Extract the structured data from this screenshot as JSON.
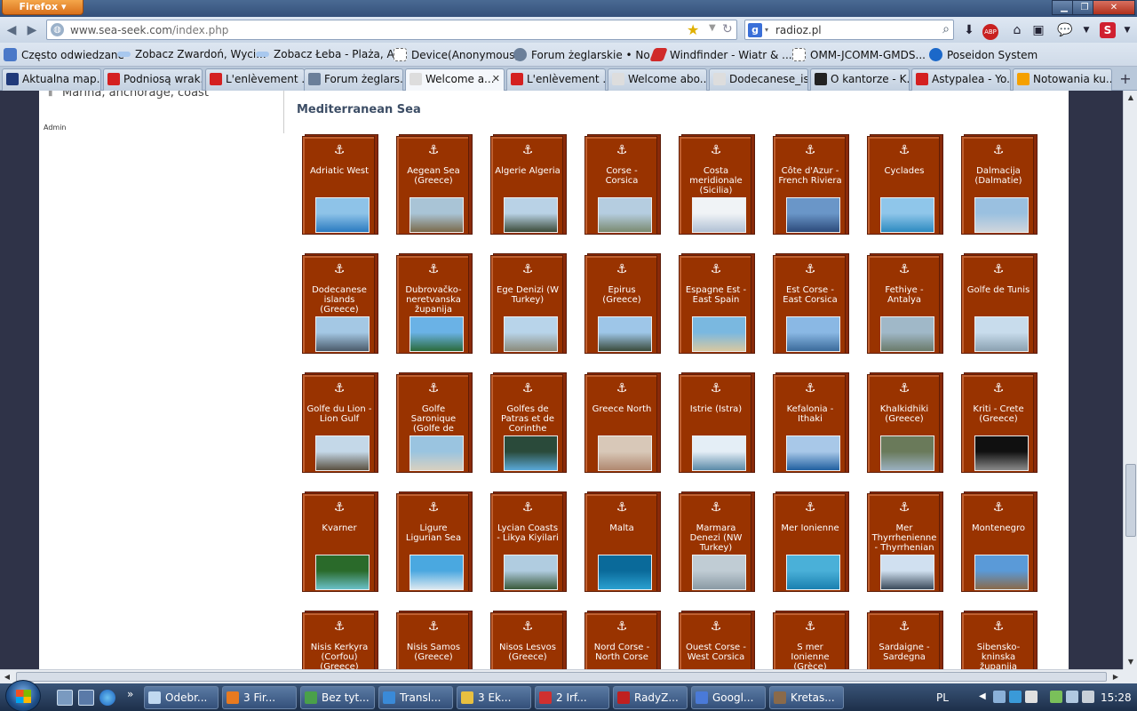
{
  "browser": {
    "app_button": "Firefox",
    "url_host": "www.sea-seek.com",
    "url_path": "/index.php",
    "search_engine": "g",
    "search_text": "radioz.pl"
  },
  "bookmarks": [
    {
      "label": "Często odwiedzane",
      "color": "#4a78c8"
    },
    {
      "label": "Zobacz Zwardoń, Wyci...",
      "color": "#a8c8ee"
    },
    {
      "label": "Zobacz Łeba - Plaża, A...",
      "color": "#a8c8ee"
    },
    {
      "label": "Device(Anonymous)",
      "color": "#ffffff"
    },
    {
      "label": "Forum żeglarskie • No...",
      "color": "#6b7f99"
    },
    {
      "label": "Windfinder - Wiatr & ...",
      "color": "#d02a2a"
    },
    {
      "label": "OMM-JCOMM-GMDS...",
      "color": "#ffffff"
    },
    {
      "label": "Poseidon System",
      "color": "#1b68c9"
    }
  ],
  "tabs": [
    {
      "label": "Aktualna map...",
      "color": "#203a7a"
    },
    {
      "label": "Podniosą wrak...",
      "color": "#d42020"
    },
    {
      "label": "L'enlèvement ...",
      "color": "#d42020"
    },
    {
      "label": "Forum żeglars...",
      "color": "#6b7f99"
    },
    {
      "label": "Welcome a...",
      "color": "#dddddd",
      "active": true
    },
    {
      "label": "L'enlèvement ...",
      "color": "#d42020"
    },
    {
      "label": "Welcome abo...",
      "color": "#dddddd"
    },
    {
      "label": "Dodecanese_is...",
      "color": "#dddddd"
    },
    {
      "label": "O kantorze - K...",
      "color": "#222222"
    },
    {
      "label": "Astypalea - Yo...",
      "color": "#d42020"
    },
    {
      "label": "Notowania ku...",
      "color": "#f5a000"
    }
  ],
  "sidebar": {
    "marina_text": "Marina, anchorage, coast",
    "admin_link": "Admin"
  },
  "section_title": "Mediterranean Sea",
  "regions": [
    {
      "name": "Adriatic West",
      "thumb": [
        "#8ec3e8",
        "#2a7ac0"
      ]
    },
    {
      "name": "Aegean Sea (Greece)",
      "thumb": [
        "#a9c4d6",
        "#7a6a4a"
      ]
    },
    {
      "name": "Algerie Algeria",
      "thumb": [
        "#b9d2e6",
        "#3b4a38"
      ]
    },
    {
      "name": "Corse - Corsica",
      "thumb": [
        "#b5cde0",
        "#7a8a70"
      ]
    },
    {
      "name": "Costa meridionale (Sicilia)",
      "thumb": [
        "#f0f3f6",
        "#b0c0d4"
      ]
    },
    {
      "name": "Côte d'Azur - French Riviera",
      "thumb": [
        "#6a96c8",
        "#2b4a7a"
      ]
    },
    {
      "name": "Cyclades",
      "thumb": [
        "#8fc6ea",
        "#2d8ac0"
      ]
    },
    {
      "name": "Dalmacija (Dalmatie)",
      "thumb": [
        "#9ac0e0",
        "#d0d6dc"
      ]
    },
    {
      "name": "Dodecanese islands (Greece)",
      "thumb": [
        "#a4c8e4",
        "#4a5a6a"
      ]
    },
    {
      "name": "Dubrovačko-neretvanska županija",
      "thumb": [
        "#6ab2e6",
        "#2a6a3a"
      ]
    },
    {
      "name": "Ege Denizi (W Turkey)",
      "thumb": [
        "#b8d4ea",
        "#8a8a7a"
      ]
    },
    {
      "name": "Epirus (Greece)",
      "thumb": [
        "#9ec6e8",
        "#3a4a3a"
      ]
    },
    {
      "name": "Espagne Est - East Spain",
      "thumb": [
        "#7ab8e0",
        "#d8c8a0"
      ]
    },
    {
      "name": "Est Corse - East Corsica",
      "thumb": [
        "#8ab8e4",
        "#3a6a9a"
      ]
    },
    {
      "name": "Fethiye - Antalya",
      "thumb": [
        "#a0b8c8",
        "#6a7a6a"
      ]
    },
    {
      "name": "Golfe de Tunis",
      "thumb": [
        "#c8dcec",
        "#8aa0b0"
      ]
    },
    {
      "name": "Golfe du Lion - Lion Gulf",
      "thumb": [
        "#c4d8e8",
        "#5a5040"
      ]
    },
    {
      "name": "Golfe Saronique (Golfe de",
      "thumb": [
        "#9ac4e0",
        "#d8d0c0"
      ]
    },
    {
      "name": "Golfes de Patras et de Corinthe",
      "thumb": [
        "#2a4a3a",
        "#5aa8d8"
      ]
    },
    {
      "name": "Greece North",
      "thumb": [
        "#d8c8b8",
        "#b08870"
      ]
    },
    {
      "name": "Istrie (Istra)",
      "thumb": [
        "#e4eef6",
        "#5a8aa8"
      ]
    },
    {
      "name": "Kefalonia - Ithaki",
      "thumb": [
        "#a8c8e8",
        "#2060a0"
      ]
    },
    {
      "name": "Khalkidhiki (Greece)",
      "thumb": [
        "#6a7a5a",
        "#9ab0c0"
      ]
    },
    {
      "name": "Kriti - Crete (Greece)",
      "thumb": [
        "#101010",
        "#8a8a8a"
      ]
    },
    {
      "name": "Kvarner",
      "thumb": [
        "#2a6a2a",
        "#6ac0c8"
      ]
    },
    {
      "name": "Ligure Ligurian Sea",
      "thumb": [
        "#4aa8e0",
        "#dce8f0"
      ]
    },
    {
      "name": "Lycian Coasts - Likya Kiyilari",
      "thumb": [
        "#b0cce0",
        "#3a5a3a"
      ]
    },
    {
      "name": "Malta",
      "thumb": [
        "#0a6a9a",
        "#2aa0d0"
      ]
    },
    {
      "name": "Marmara Denezi (NW Turkey)",
      "thumb": [
        "#c0ccd4",
        "#8a9aa4"
      ]
    },
    {
      "name": "Mer Ionienne",
      "thumb": [
        "#4ab0d8",
        "#1a80b0"
      ]
    },
    {
      "name": "Mer Thyrrhenienne - Thyrrhenian",
      "thumb": [
        "#d0e0f0",
        "#3a4a5a"
      ]
    },
    {
      "name": "Montenegro",
      "thumb": [
        "#5a9ad8",
        "#8a6a4a"
      ]
    },
    {
      "name": "Nisis Kerkyra (Corfou) (Greece)",
      "thumb": [
        "#9ac0e0",
        "#4a6a4a"
      ]
    },
    {
      "name": "Nisis Samos (Greece)",
      "thumb": [
        "#8ab8e0",
        "#5a7a5a"
      ]
    },
    {
      "name": "Nisos Lesvos (Greece)",
      "thumb": [
        "#a0c4e0",
        "#6a6a5a"
      ]
    },
    {
      "name": "Nord Corse - North Corse",
      "thumb": [
        "#7ab0dc",
        "#4a6a4a"
      ]
    },
    {
      "name": "Ouest Corse - West Corsica",
      "thumb": [
        "#8ab8e0",
        "#6a7a5a"
      ]
    },
    {
      "name": "S mer Ionienne (Grèce)",
      "thumb": [
        "#6aaee0",
        "#2a6aa0"
      ]
    },
    {
      "name": "Sardaigne - Sardegna",
      "thumb": [
        "#90c4e8",
        "#d8c8a0"
      ]
    },
    {
      "name": "Šibensko-kninska županija",
      "thumb": [
        "#98c0e0",
        "#c8c0b0"
      ]
    }
  ],
  "taskbar": {
    "tasks": [
      {
        "label": "Odebr...",
        "color": "#c0d8f0"
      },
      {
        "label": "3 Fir...",
        "color": "#e87a20"
      },
      {
        "label": "Bez tyt...",
        "color": "#4aa04a"
      },
      {
        "label": "Transl...",
        "color": "#3a8ad8"
      },
      {
        "label": "3 Ek...",
        "color": "#e8c040"
      },
      {
        "label": "2 Irf...",
        "color": "#d03030"
      },
      {
        "label": "RadyZ...",
        "color": "#c02020"
      },
      {
        "label": "Googl...",
        "color": "#4a7ad8"
      },
      {
        "label": "Kretas...",
        "color": "#8a6a4a"
      }
    ],
    "language": "PL",
    "clock": "15:28"
  }
}
